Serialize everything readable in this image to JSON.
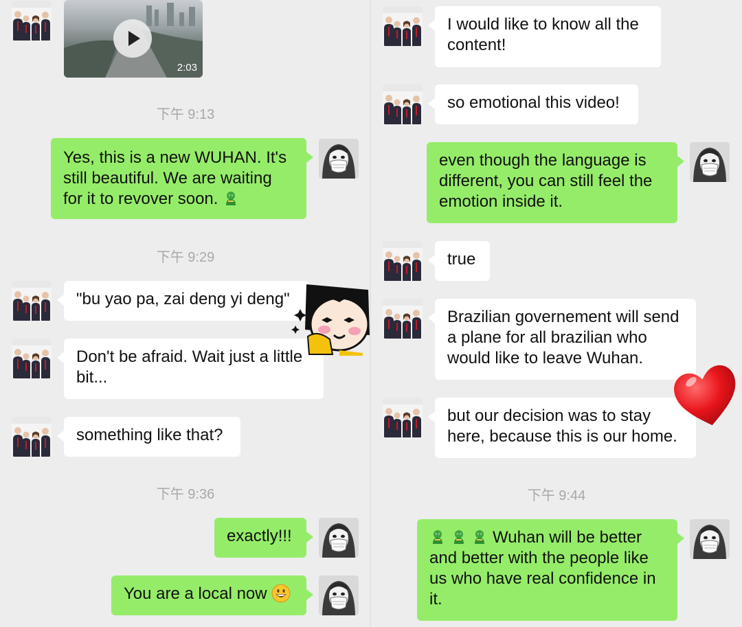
{
  "left": {
    "video": {
      "duration": "2:03"
    },
    "times": [
      "下午 9:13",
      "下午 9:29",
      "下午 9:36"
    ],
    "messages": [
      {
        "side": "out",
        "text": "Yes, this is a new WUHAN. It's still beautiful. We are waiting for it to revover soon.",
        "emoji": "green-doll-emoji"
      },
      {
        "side": "in",
        "text": "\"bu yao pa, zai deng yi deng\""
      },
      {
        "side": "in",
        "text": "Don't be afraid. Wait just a little bit..."
      },
      {
        "side": "in",
        "text": "something like that?"
      },
      {
        "side": "out",
        "text": "exactly!!!"
      },
      {
        "side": "out",
        "text": "You are a local now",
        "emoji": "grinning-face-emoji"
      }
    ]
  },
  "right": {
    "times": [
      "下午 9:44"
    ],
    "messages": [
      {
        "side": "in",
        "text": "I would like to know all the content!"
      },
      {
        "side": "in",
        "text": "so emotional this video!"
      },
      {
        "side": "out",
        "text": "even though the language is different, you can still feel the emotion inside it."
      },
      {
        "side": "in",
        "text": "true"
      },
      {
        "side": "in",
        "text": "Brazilian governement will send a plane for all brazilian who would like to leave Wuhan."
      },
      {
        "side": "in",
        "text": "but our decision was to stay here, because this is our home."
      },
      {
        "side": "out",
        "text": "Wuhan will be better and better with the people like us who have real confidence in it.",
        "emoji": "green-doll-emoji-x3"
      }
    ]
  },
  "colors": {
    "background": "#ededed",
    "incoming_bubble": "#ffffff",
    "outgoing_bubble": "#95ec69",
    "timestamp": "#a8a8a8",
    "heart": "#e8141b"
  }
}
